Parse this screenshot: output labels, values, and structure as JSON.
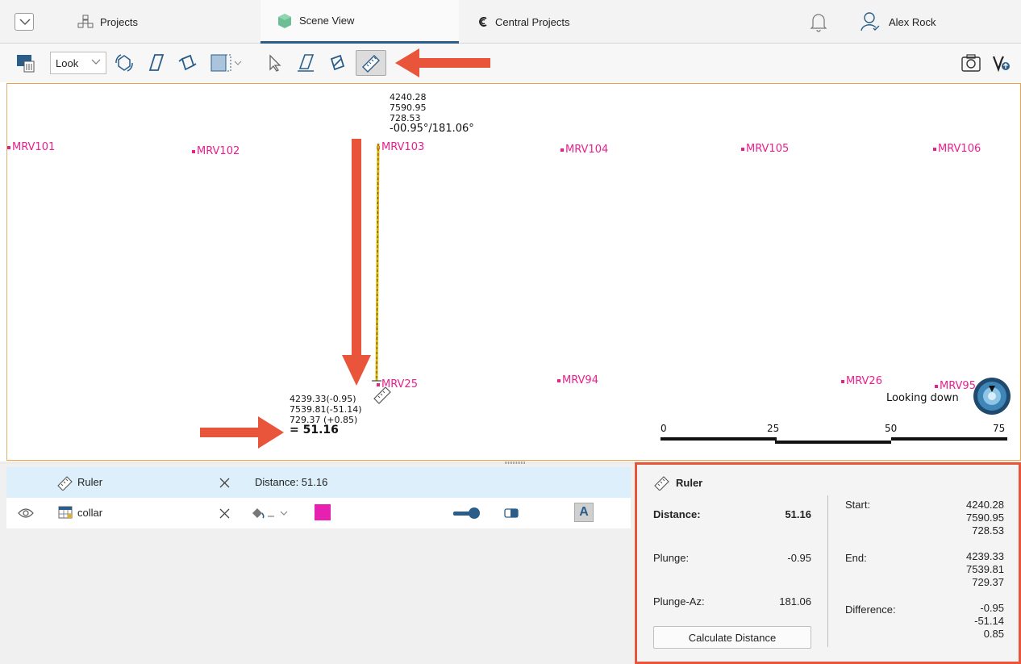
{
  "topbar": {
    "menu_icon": "chevron-down-icon",
    "tabs": [
      {
        "label": "Projects",
        "icon": "projects-icon"
      },
      {
        "label": "Scene View",
        "icon": "cube-icon"
      },
      {
        "label": "Central Projects",
        "icon": "central-icon"
      }
    ],
    "user_name": "Alex Rock",
    "notification_icon": "bell-icon"
  },
  "toolbar": {
    "look_label": "Look",
    "tools": [
      "clear-scene-icon",
      "rotate-icon",
      "draw-plane-icon",
      "slice-icon",
      "view-split-icon",
      "select-icon",
      "draw-line-icon",
      "polygon-icon",
      "ruler-icon"
    ],
    "right_icons": [
      "camera-icon",
      "upload-icon"
    ]
  },
  "viewport": {
    "wells": [
      "MRV101",
      "MRV102",
      "MRV103",
      "MRV104",
      "MRV105",
      "MRV106",
      "MRV25",
      "MRV94",
      "MRV26",
      "MRV95"
    ],
    "start_label": [
      "4240.28",
      "7590.95",
      "728.53",
      "-00.95°/181.06°"
    ],
    "end_label": [
      "4239.33(-0.95)",
      "7539.81(-51.14)",
      "729.37  (+0.85)",
      "= 51.16"
    ],
    "looking": "Looking down",
    "scale_ticks": [
      "0",
      "25",
      "50",
      "75"
    ]
  },
  "objects": [
    {
      "name": "Ruler",
      "info": "Distance: 51.16",
      "icon": "ruler-icon"
    },
    {
      "name": "collar",
      "icon": "table-icon",
      "color": "#e820b0"
    }
  ],
  "props": {
    "title": "Ruler",
    "distance_label": "Distance:",
    "distance_value": "51.16",
    "plunge_label": "Plunge:",
    "plunge_value": "-0.95",
    "plunge_az_label": "Plunge-Az:",
    "plunge_az_value": "181.06",
    "calc_button": "Calculate Distance",
    "start_label": "Start:",
    "start_values": [
      "4240.28",
      "7590.95",
      "728.53"
    ],
    "end_label": "End:",
    "end_values": [
      "4239.33",
      "7539.81",
      "729.37"
    ],
    "difference_label": "Difference:",
    "difference_values": [
      "-0.95",
      "-51.14",
      "0.85"
    ]
  },
  "colors": {
    "accent": "#2a5d8a",
    "well": "#e8208e",
    "highlight": "#e8553a"
  }
}
